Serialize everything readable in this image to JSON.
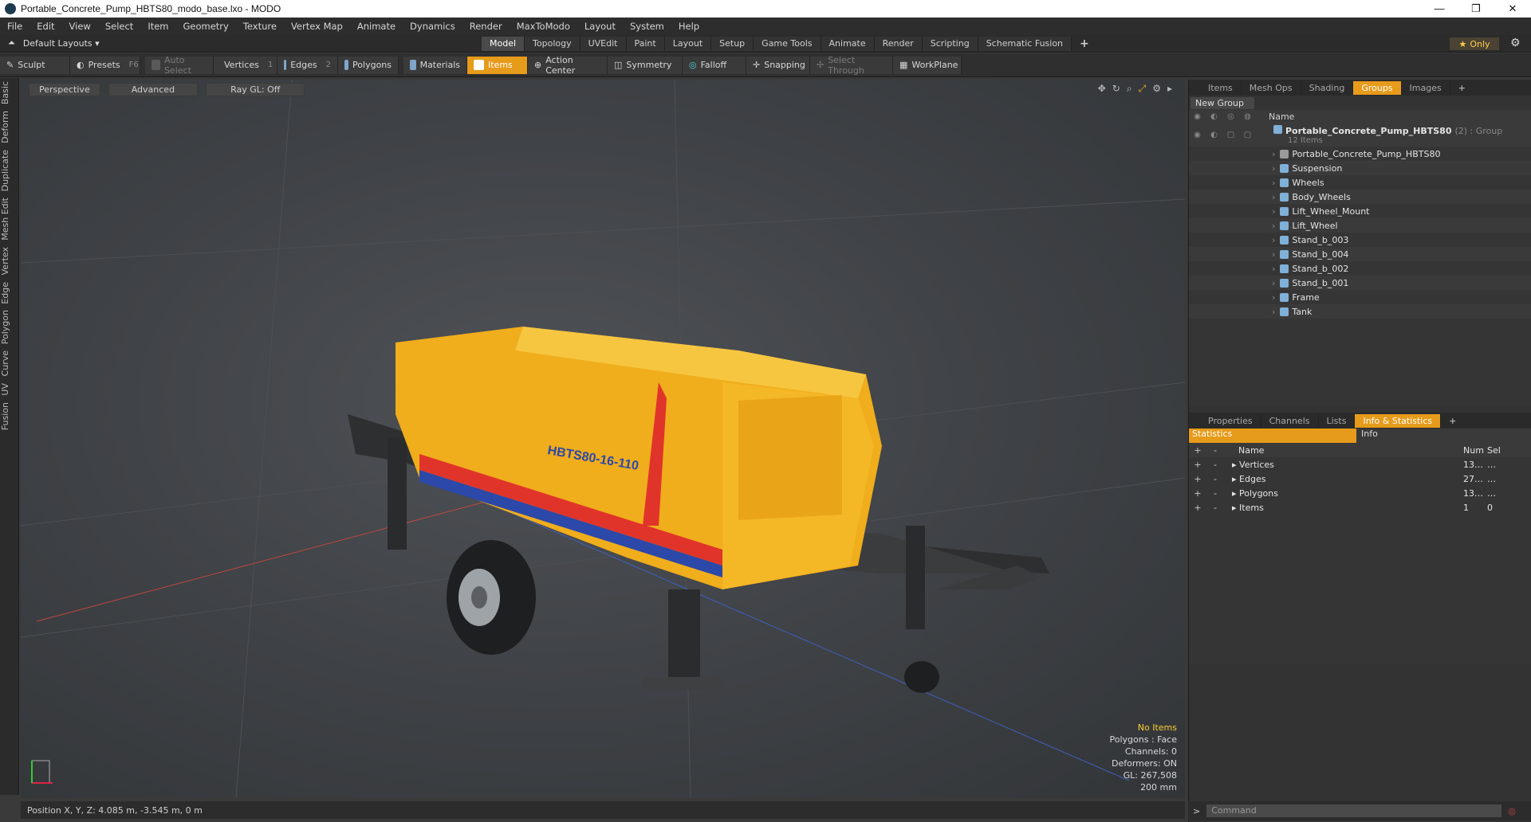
{
  "window": {
    "title": "Portable_Concrete_Pump_HBTS80_modo_base.lxo - MODO",
    "controls": [
      "—",
      "❐",
      "✕"
    ]
  },
  "menu": [
    "File",
    "Edit",
    "View",
    "Select",
    "Item",
    "Geometry",
    "Texture",
    "Vertex Map",
    "Animate",
    "Dynamics",
    "Render",
    "MaxToModo",
    "Layout",
    "System",
    "Help"
  ],
  "layouts": {
    "selector": "Default Layouts ▾",
    "tabs": [
      "Model",
      "Topology",
      "UVEdit",
      "Paint",
      "Layout",
      "Setup",
      "Game Tools",
      "Animate",
      "Render",
      "Scripting",
      "Schematic Fusion"
    ],
    "active_tab": "Model",
    "only": "Only"
  },
  "toolbar": {
    "sculpt": "Sculpt",
    "presets": "Presets",
    "presets_key": "F6",
    "auto_select": "Auto Select",
    "vertices": "Vertices",
    "vertices_count": "1",
    "edges": "Edges",
    "edges_count": "2",
    "polygons": "Polygons",
    "materials": "Materials",
    "items": "Items",
    "action_center": "Action Center",
    "symmetry": "Symmetry",
    "falloff": "Falloff",
    "snapping": "Snapping",
    "select_through": "Select Through",
    "workplane": "WorkPlane"
  },
  "left_tabs": [
    "Basic",
    "Deform",
    "Duplicate",
    "Mesh Edit",
    "Vertex",
    "Edge",
    "Polygon",
    "Curve",
    "UV",
    "Fusion"
  ],
  "viewport": {
    "perspective": "Perspective",
    "advanced": "Advanced",
    "raygl": "Ray GL: Off",
    "model_label": "HBTS80-16-110",
    "stats": {
      "selection": "No Items",
      "polygons": "Polygons : Face",
      "channels": "Channels: 0",
      "deformers": "Deformers: ON",
      "gl": "GL: 267,508",
      "scale": "200 mm"
    }
  },
  "status": {
    "position": "Position X, Y, Z:  4.085 m, -3.545 m, 0 m"
  },
  "top_panel": {
    "tabs": [
      "Items",
      "Mesh Ops",
      "Shading",
      "Groups",
      "Images"
    ],
    "active_tab": "Groups",
    "new_group": "New Group",
    "col_name": "Name",
    "group": {
      "name": "Portable_Concrete_Pump_HBTS80",
      "suffix": "(2) : Group",
      "count": "12 Items"
    },
    "children": [
      "Portable_Concrete_Pump_HBTS80",
      "Suspension",
      "Wheels",
      "Body_Wheels",
      "Lift_Wheel_Mount",
      "Lift_Wheel",
      "Stand_b_003",
      "Stand_b_004",
      "Stand_b_002",
      "Stand_b_001",
      "Frame",
      "Tank"
    ]
  },
  "bottom_panel": {
    "tabs": [
      "Properties",
      "Channels",
      "Lists",
      "Info & Statistics"
    ],
    "active_tab": "Info & Statistics",
    "statistics": "Statistics",
    "info": "Info",
    "cols": {
      "name": "Name",
      "num": "Num",
      "sel": "Sel"
    },
    "rows": [
      {
        "name": "Vertices",
        "num": "13…",
        "sel": "…"
      },
      {
        "name": "Edges",
        "num": "27…",
        "sel": "…"
      },
      {
        "name": "Polygons",
        "num": "13…",
        "sel": "…"
      },
      {
        "name": "Items",
        "num": "1",
        "sel": "0"
      }
    ]
  },
  "command": {
    "placeholder": "Command",
    "prompt": ">"
  },
  "colors": {
    "accent": "#e79b1a",
    "pump_body": "#f2b320",
    "stripe_red": "#e0342a",
    "stripe_blue": "#2c48a8"
  }
}
